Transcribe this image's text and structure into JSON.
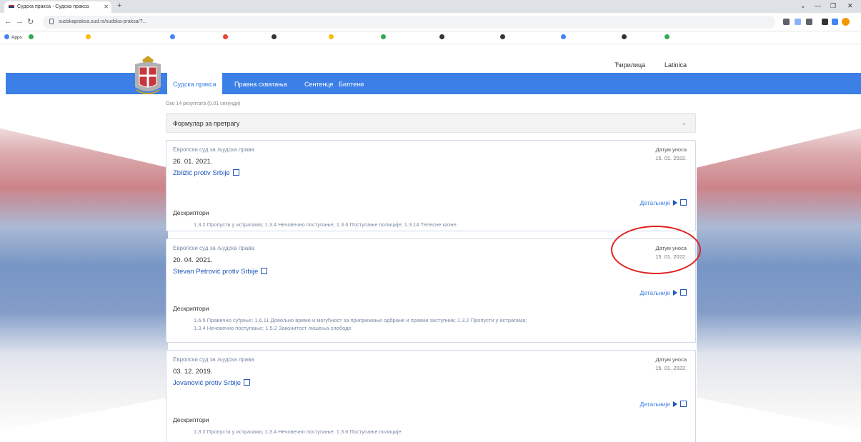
{
  "browser": {
    "tab_title": "Судска пракса - Судска пракса",
    "url": "sudskapraksa.sud.rs/sudska-praksa/?..."
  },
  "bookmarks": [
    {
      "label": "Apps",
      "color": "#4285f4"
    },
    {
      "label": "",
      "color": "#34a853"
    },
    {
      "label": "",
      "color": "#fbbc05"
    },
    {
      "label": "",
      "color": "#4285f4"
    },
    {
      "label": "",
      "color": "#ea4335"
    },
    {
      "label": "",
      "color": "#333333"
    },
    {
      "label": "",
      "color": "#fbbc05"
    },
    {
      "label": "",
      "color": "#34a853"
    },
    {
      "label": "",
      "color": "#333333"
    },
    {
      "label": "",
      "color": "#333333"
    },
    {
      "label": "",
      "color": "#4285f4"
    },
    {
      "label": "",
      "color": "#333333"
    },
    {
      "label": "",
      "color": "#34a853"
    }
  ],
  "header": {
    "links": [
      "Ћирилица",
      "Latinica"
    ]
  },
  "nav": {
    "items": [
      "Судска пракса",
      "Правна схватања",
      "Сентенце",
      "Билтени"
    ],
    "active_index": 0
  },
  "results_info": "Око 14 резултата (0,01 секунди)",
  "filter": {
    "label": "Формулар за претрагу"
  },
  "cards": [
    {
      "court": "Европски суд за људска права",
      "date": "26. 01. 2021.",
      "case": "Zbližić protiv Srbije",
      "decision_label": "Датум уноса",
      "decision_date": "15. 01. 2022.",
      "details_label": "Детаљније",
      "descriptors_label": "Дескриптори",
      "descriptors": [
        "1.3.2 Пропусти у истрагама; 1.3.4 Нечовечно поступање; 1.3.6 Поступање полиције; 1.3.14 Телесне казне"
      ]
    },
    {
      "court": "Европски суд за људска права",
      "date": "20. 04. 2021.",
      "case": "Stevan Petrović protiv Srbije",
      "decision_label": "Датум уноса",
      "decision_date": "15. 01. 2022.",
      "details_label": "Детаљније",
      "descriptors_label": "Дескриптори",
      "descriptors": [
        "1.6.5 Правично суђење; 1.6.11 Довољно време и могућност за припремање одбране и правни заступник; 1.3.2 Пропусти у истрагама;",
        "1.3.4 Нечовечно поступање; 1.5.2 Законитост лишења слободе"
      ]
    },
    {
      "court": "Европски суд за људска права",
      "date": "03. 12. 2019.",
      "case": "Jovanović protiv Srbije",
      "decision_label": "Датум уноса",
      "decision_date": "15. 01. 2022.",
      "details_label": "Детаљније",
      "descriptors_label": "Дескриптори",
      "descriptors": [
        "1.3.2 Пропусти у истрагама; 1.3.4 Нечовечно поступање; 1.3.6 Поступање полиције"
      ]
    }
  ],
  "colors": {
    "nav_blue": "#3c7fe6",
    "link_blue": "#1f56b8",
    "highlight_red": "#e02020"
  }
}
